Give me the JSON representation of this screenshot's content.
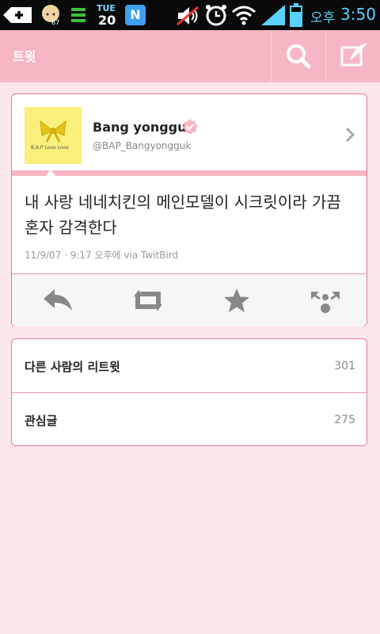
{
  "status_bar": {
    "date_day": "TUE",
    "date_num": "20",
    "badge_count": "67",
    "n_app_letter": "N",
    "clock_ampm": "오후",
    "clock_time": "3:50"
  },
  "action_bar": {
    "title": "트윗",
    "search_icon": "search-icon",
    "compose_icon": "compose-icon"
  },
  "tweet": {
    "user_name": "Bang yongguk",
    "user_handle": "@BAP_Bangyongguk",
    "avatar_text": "B.A.P Love Love",
    "text": "내 사랑 네네치킨의 메인모델이 시크릿이라 가끔 혼자 감격한다",
    "meta": "11/9/07 · 9:17 오후에 via TwitBird",
    "actions": [
      "reply-icon",
      "retweet-icon",
      "favorite-icon",
      "more-icon"
    ]
  },
  "stats": [
    {
      "label": "다른 사람의 리트윗",
      "value": "301"
    },
    {
      "label": "관심글",
      "value": "275"
    }
  ],
  "colors": {
    "accent": "#f7b6c3",
    "background": "#fbe6ea",
    "border": "#e07e95",
    "status_blue": "#5ad1ff"
  }
}
